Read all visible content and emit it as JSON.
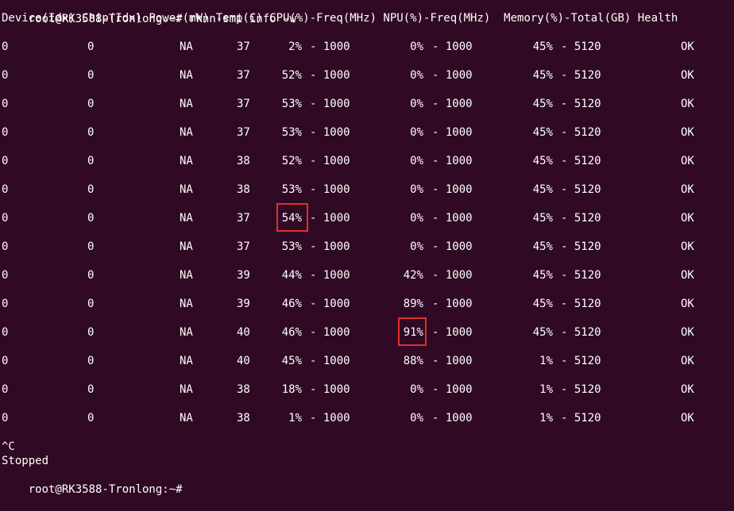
{
  "window": {
    "prompt": "root@RK3588-Tronlong:~#",
    "command": "rknn-smi info -w"
  },
  "table": {
    "header": "Device(Idx) Chip(Idx) Power(mW) Temp(C) CPU(%)-Freq(MHz) NPU(%)-Freq(MHz)  Memory(%)-Total(GB) Health",
    "rows": [
      {
        "device": "0",
        "chip": "0",
        "power": "NA",
        "temp": "37",
        "cpu": "2%",
        "cpu_freq": "- 1000",
        "npu": "0%",
        "npu_freq": "- 1000",
        "mem": "45%",
        "mem_total": "- 5120",
        "health": "OK"
      },
      {
        "device": "0",
        "chip": "0",
        "power": "NA",
        "temp": "37",
        "cpu": "52%",
        "cpu_freq": "- 1000",
        "npu": "0%",
        "npu_freq": "- 1000",
        "mem": "45%",
        "mem_total": "- 5120",
        "health": "OK"
      },
      {
        "device": "0",
        "chip": "0",
        "power": "NA",
        "temp": "37",
        "cpu": "53%",
        "cpu_freq": "- 1000",
        "npu": "0%",
        "npu_freq": "- 1000",
        "mem": "45%",
        "mem_total": "- 5120",
        "health": "OK"
      },
      {
        "device": "0",
        "chip": "0",
        "power": "NA",
        "temp": "37",
        "cpu": "53%",
        "cpu_freq": "- 1000",
        "npu": "0%",
        "npu_freq": "- 1000",
        "mem": "45%",
        "mem_total": "- 5120",
        "health": "OK"
      },
      {
        "device": "0",
        "chip": "0",
        "power": "NA",
        "temp": "38",
        "cpu": "52%",
        "cpu_freq": "- 1000",
        "npu": "0%",
        "npu_freq": "- 1000",
        "mem": "45%",
        "mem_total": "- 5120",
        "health": "OK"
      },
      {
        "device": "0",
        "chip": "0",
        "power": "NA",
        "temp": "38",
        "cpu": "53%",
        "cpu_freq": "- 1000",
        "npu": "0%",
        "npu_freq": "- 1000",
        "mem": "45%",
        "mem_total": "- 5120",
        "health": "OK"
      },
      {
        "device": "0",
        "chip": "0",
        "power": "NA",
        "temp": "37",
        "cpu": "54%",
        "cpu_freq": "- 1000",
        "npu": "0%",
        "npu_freq": "- 1000",
        "mem": "45%",
        "mem_total": "- 5120",
        "health": "OK"
      },
      {
        "device": "0",
        "chip": "0",
        "power": "NA",
        "temp": "37",
        "cpu": "53%",
        "cpu_freq": "- 1000",
        "npu": "0%",
        "npu_freq": "- 1000",
        "mem": "45%",
        "mem_total": "- 5120",
        "health": "OK"
      },
      {
        "device": "0",
        "chip": "0",
        "power": "NA",
        "temp": "39",
        "cpu": "44%",
        "cpu_freq": "- 1000",
        "npu": "42%",
        "npu_freq": "- 1000",
        "mem": "45%",
        "mem_total": "- 5120",
        "health": "OK"
      },
      {
        "device": "0",
        "chip": "0",
        "power": "NA",
        "temp": "39",
        "cpu": "46%",
        "cpu_freq": "- 1000",
        "npu": "89%",
        "npu_freq": "- 1000",
        "mem": "45%",
        "mem_total": "- 5120",
        "health": "OK"
      },
      {
        "device": "0",
        "chip": "0",
        "power": "NA",
        "temp": "40",
        "cpu": "46%",
        "cpu_freq": "- 1000",
        "npu": "91%",
        "npu_freq": "- 1000",
        "mem": "45%",
        "mem_total": "- 5120",
        "health": "OK"
      },
      {
        "device": "0",
        "chip": "0",
        "power": "NA",
        "temp": "40",
        "cpu": "45%",
        "cpu_freq": "- 1000",
        "npu": "88%",
        "npu_freq": "- 1000",
        "mem": "1%",
        "mem_total": "- 5120",
        "health": "OK"
      },
      {
        "device": "0",
        "chip": "0",
        "power": "NA",
        "temp": "38",
        "cpu": "18%",
        "cpu_freq": "- 1000",
        "npu": "0%",
        "npu_freq": "- 1000",
        "mem": "1%",
        "mem_total": "- 5120",
        "health": "OK"
      },
      {
        "device": "0",
        "chip": "0",
        "power": "NA",
        "temp": "38",
        "cpu": "1%",
        "cpu_freq": "- 1000",
        "npu": "0%",
        "npu_freq": "- 1000",
        "mem": "1%",
        "mem_total": "- 5120",
        "health": "OK"
      }
    ]
  },
  "footer": {
    "interrupt": "^C",
    "stopped": "Stopped",
    "prompt": "root@RK3588-Tronlong:~#"
  },
  "colors": {
    "background": "#300a24",
    "foreground": "#ffffff",
    "highlight": "#e03030"
  }
}
